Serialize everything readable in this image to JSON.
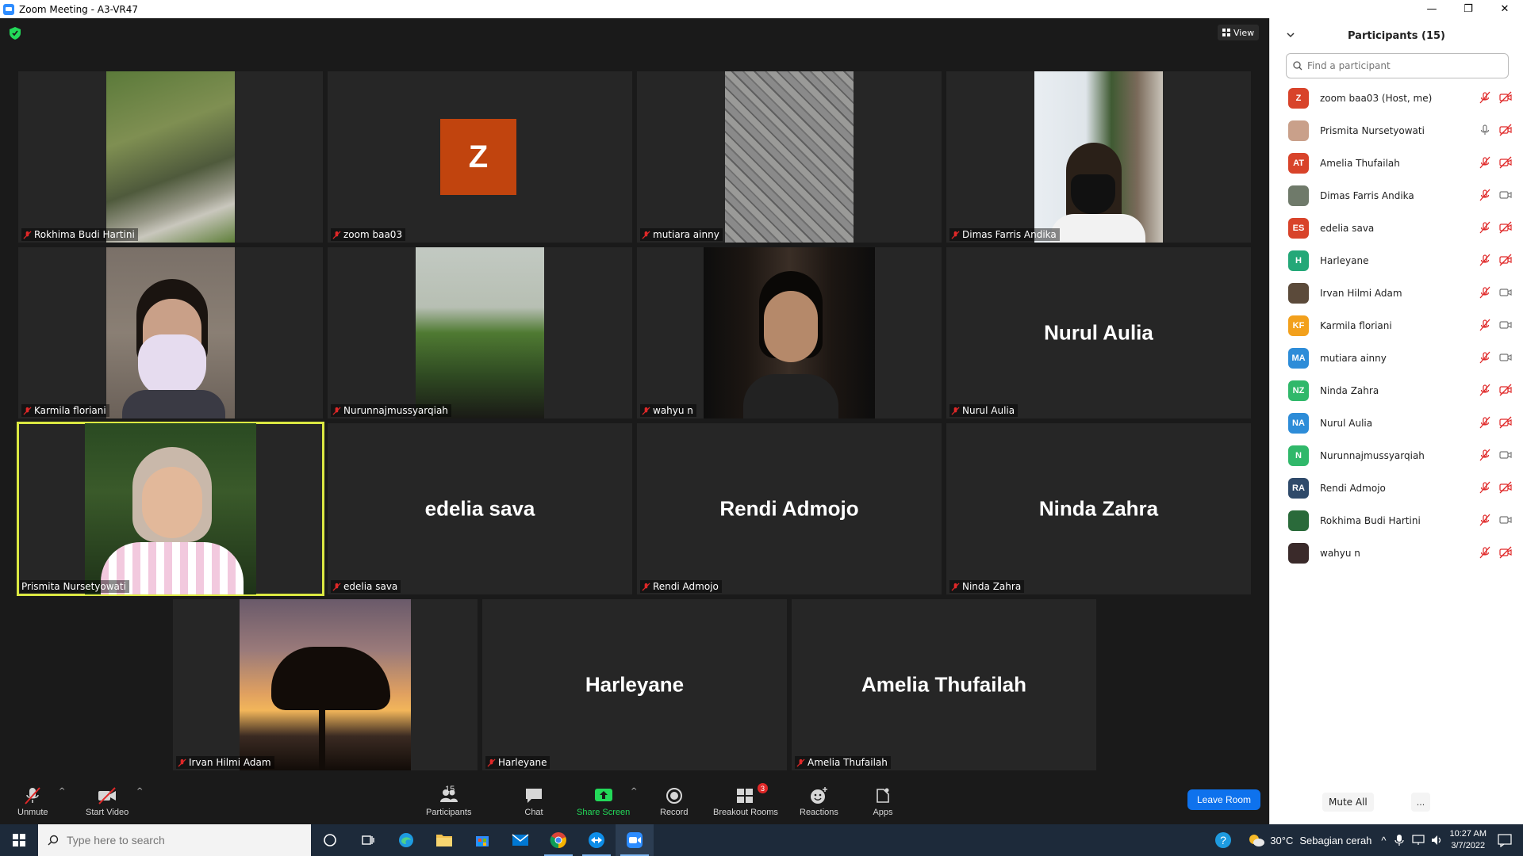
{
  "window": {
    "title": "Zoom Meeting - A3-VR47"
  },
  "meeting": {
    "view_label": "View",
    "tiles": [
      {
        "name": "Rokhima Budi Hartini",
        "video": "grass-path"
      },
      {
        "name": "zoom baa03",
        "avatar_letter": "Z"
      },
      {
        "name": "mutiara ainny",
        "video": "paving"
      },
      {
        "name": "Dimas Farris Andika",
        "video": "masked-man"
      },
      {
        "name": "Karmila floriani",
        "video": "masked-woman"
      },
      {
        "name": "Nurunnajmussyarqiah",
        "video": "wall-grass"
      },
      {
        "name": "wahyu n",
        "video": "portrait-dark"
      },
      {
        "name": "Nurul Aulia",
        "display": "Nurul Aulia"
      },
      {
        "name": "Prismita Nursetyowati",
        "video": "hijab-woman",
        "active_speaker": true
      },
      {
        "name": "edelia sava",
        "display": "edelia sava"
      },
      {
        "name": "Rendi Admojo",
        "display": "Rendi Admojo"
      },
      {
        "name": "Ninda Zahra",
        "display": "Ninda Zahra"
      },
      {
        "name": "Irvan Hilmi Adam",
        "video": "sunset-tree"
      },
      {
        "name": "Harleyane",
        "display": "Harleyane"
      },
      {
        "name": "Amelia Thufailah",
        "display": "Amelia Thufailah"
      }
    ]
  },
  "toolbar": {
    "unmute": "Unmute",
    "start_video": "Start Video",
    "participants": "Participants",
    "participants_count": "15",
    "chat": "Chat",
    "share_screen": "Share Screen",
    "record": "Record",
    "breakout_rooms": "Breakout Rooms",
    "breakout_badge": "3",
    "reactions": "Reactions",
    "apps": "Apps",
    "leave": "Leave Room"
  },
  "panel": {
    "title": "Participants (15)",
    "search_placeholder": "Find a participant",
    "mute_all": "Mute All",
    "more": "...",
    "participants": [
      {
        "initials": "Z",
        "color": "#d8432a",
        "name": "zoom baa03 (Host, me)",
        "mic": "muted",
        "video": "off"
      },
      {
        "initials": "",
        "color": "#c9a08a",
        "name": "Prismita Nursetyowati",
        "mic": "on",
        "video": "off"
      },
      {
        "initials": "AT",
        "color": "#d8432a",
        "name": "Amelia Thufailah",
        "mic": "muted",
        "video": "off"
      },
      {
        "initials": "",
        "color": "#6f7a6a",
        "name": "Dimas Farris Andika",
        "mic": "muted",
        "video": "on"
      },
      {
        "initials": "ES",
        "color": "#d8432a",
        "name": "edelia sava",
        "mic": "muted",
        "video": "off"
      },
      {
        "initials": "H",
        "color": "#24a878",
        "name": "Harleyane",
        "mic": "muted",
        "video": "off"
      },
      {
        "initials": "",
        "color": "#5b4a3a",
        "name": "Irvan Hilmi Adam",
        "mic": "muted",
        "video": "on"
      },
      {
        "initials": "KF",
        "color": "#f2a01c",
        "name": "Karmila floriani",
        "mic": "muted",
        "video": "on"
      },
      {
        "initials": "MA",
        "color": "#2d8cd8",
        "name": "mutiara ainny",
        "mic": "muted",
        "video": "on"
      },
      {
        "initials": "NZ",
        "color": "#30b86a",
        "name": "Ninda Zahra",
        "mic": "muted",
        "video": "off"
      },
      {
        "initials": "NA",
        "color": "#2d8cd8",
        "name": "Nurul Aulia",
        "mic": "muted",
        "video": "off"
      },
      {
        "initials": "N",
        "color": "#30b86a",
        "name": "Nurunnajmussyarqiah",
        "mic": "muted",
        "video": "on"
      },
      {
        "initials": "RA",
        "color": "#2f4a6a",
        "name": "Rendi Admojo",
        "mic": "muted",
        "video": "off"
      },
      {
        "initials": "",
        "color": "#2a6a3a",
        "name": "Rokhima Budi Hartini",
        "mic": "muted",
        "video": "on"
      },
      {
        "initials": "",
        "color": "#3a2a2a",
        "name": "wahyu n",
        "mic": "muted",
        "video": "off"
      }
    ]
  },
  "taskbar": {
    "search_placeholder": "Type here to search",
    "temperature": "30°C",
    "weather": "Sebagian cerah",
    "time": "10:27 AM",
    "date": "3/7/2022"
  }
}
